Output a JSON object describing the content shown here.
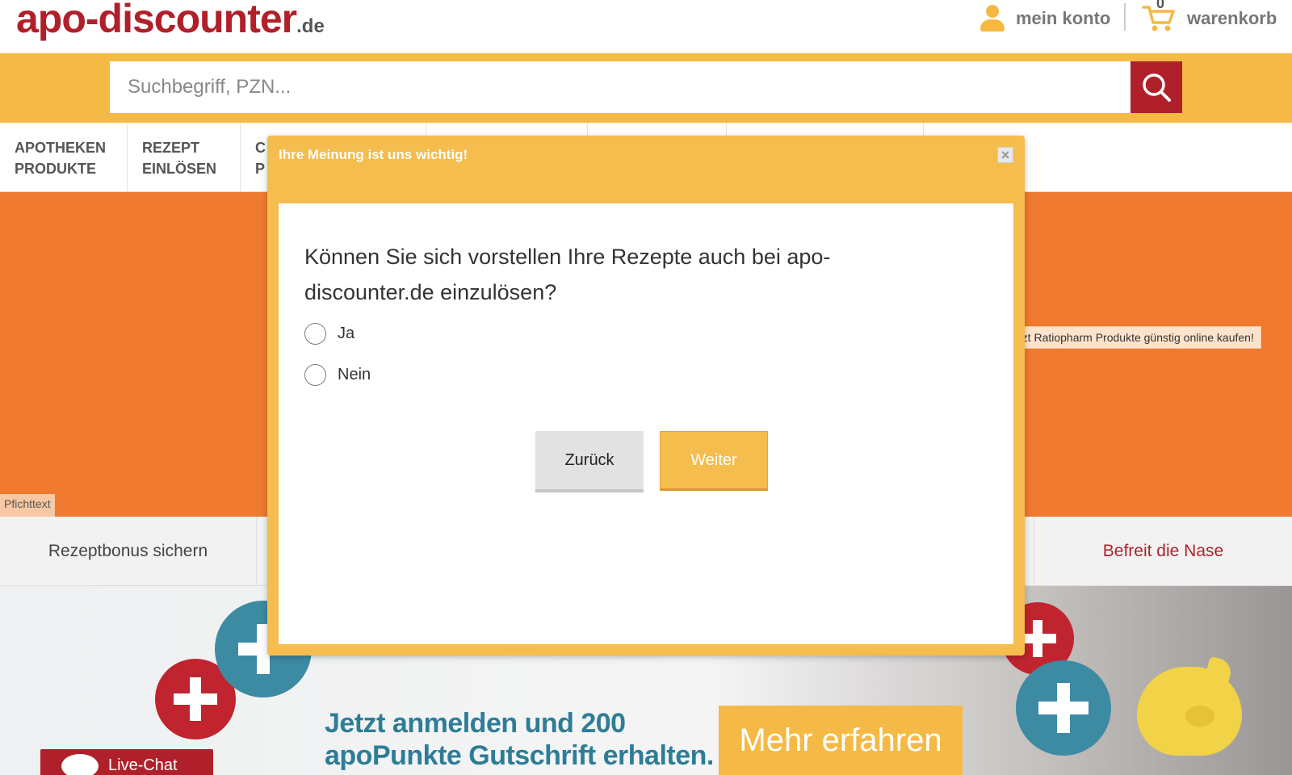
{
  "header": {
    "logo_main": "apo-discounter",
    "logo_tld": ".de",
    "account_label": "mein konto",
    "cart_label": "warenkorb",
    "cart_count": "0"
  },
  "search": {
    "placeholder": "Suchbegriff, PZN..."
  },
  "nav": {
    "items": [
      {
        "line1": "APOTHEKEN",
        "line2": "PRODUKTE"
      },
      {
        "line1": "REZEPT",
        "line2": "EINLÖSEN"
      },
      {
        "line1": "C",
        "line2": "P"
      }
    ]
  },
  "banner": {
    "pflichttext": "Pfichttext",
    "ratiopharm_tooltip": "Jetzt Ratiopharm Produkte günstig online kaufen!"
  },
  "tabs": {
    "left": "Rezeptbonus sichern",
    "right": "Befreit die Nase"
  },
  "promo": {
    "line1": "Jetzt anmelden und 200",
    "line2": "apoPunkte Gutschrift erhalten.",
    "button": "Mehr erfahren",
    "livechat": "Live-Chat"
  },
  "modal": {
    "title": "Ihre Meinung ist uns wichtig!",
    "close_symbol": "×",
    "question": "Können Sie sich vorstellen Ihre Rezepte auch bei apo-discounter.de einzulösen?",
    "options": [
      "Ja",
      "Nein"
    ],
    "back_label": "Zurück",
    "next_label": "Weiter"
  },
  "colors": {
    "brand_red": "#b0202a",
    "brand_yellow": "#f5b945",
    "banner_orange": "#ef7a30",
    "promo_teal": "#2e7d97"
  }
}
